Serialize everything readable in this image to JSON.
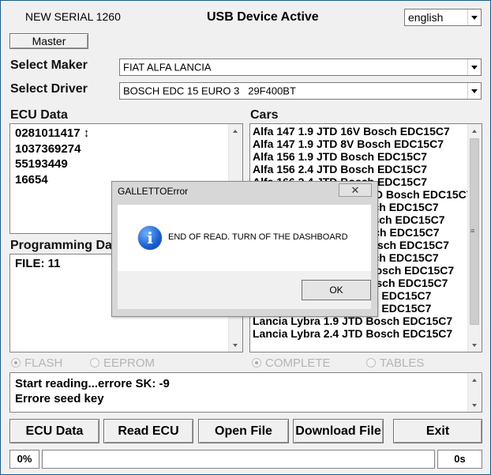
{
  "header": {
    "serial": "NEW SERIAL 1260",
    "usb_status": "USB Device Active",
    "language": "english"
  },
  "master_button": "Master",
  "maker": {
    "label": "Select Maker",
    "value": "FIAT ALFA LANCIA"
  },
  "driver": {
    "label": "Select Driver",
    "value": "BOSCH EDC 15 EURO 3   29F400BT"
  },
  "ecu_data": {
    "label": "ECU Data",
    "lines": [
      "0281011417 ↕",
      "1037369274",
      "55193449",
      "16654"
    ]
  },
  "programming_data": {
    "label": "Programming Data",
    "lines": [
      "FILE: 11"
    ]
  },
  "cars": {
    "label": "Cars",
    "items": [
      "Alfa 147 1.9 JTD 16V Bosch EDC15C7",
      "Alfa 147 1.9 JTD 8V Bosch EDC15C7",
      "Alfa 156 1.9 JTD Bosch EDC15C7",
      "Alfa 156 2.4 JTD Bosch EDC15C7",
      "Alfa 166 2.4 JTD Bosch EDC15C7",
      "Fiat Brava/Bravo 1.9 JTD Bosch EDC15C7",
      "Fiat Doblo 1.9 JTD Bosch EDC15C7",
      "Fiat Ducato 2.8 JTD Bosch EDC15C7",
      "Fiat Marea 1.9 JTD Bosch EDC15C7",
      "Fiat Multipla 1.9 JTD Bosch EDC15C7",
      "Fiat Punto 1.9 JTD Bosch EDC15C7",
      "Fiat Stilo 1.9 JTD 16V Bosch EDC15C7",
      "Fiat Stilo 1.9 JTD 8V Bosch EDC15C7",
      "Fiat Stilo 1.9 JTD Bosch EDC15C7",
      "Fiat Stilo 1.9 JTD Bosch EDC15C7",
      "Lancia Lybra 1.9 JTD Bosch EDC15C7",
      "Lancia Lybra 2.4 JTD Bosch EDC15C7"
    ]
  },
  "radios": {
    "flash": "FLASH",
    "eeprom": "EEPROM",
    "complete": "COMPLETE",
    "tables": "TABLES"
  },
  "log": {
    "lines": [
      "Start reading...errore SK: -9",
      "Errore seed key"
    ]
  },
  "buttons": {
    "ecu_data": "ECU Data",
    "read_ecu": "Read ECU",
    "open_file": "Open File",
    "download_file": "Download File",
    "exit": "Exit"
  },
  "status": {
    "percent": "0%",
    "progress": 0,
    "time": "0s"
  },
  "dialog": {
    "title": "GALLETTOError",
    "close": "✕",
    "message": "END OF READ. TURN OF THE DASHBOARD",
    "ok": "OK"
  }
}
